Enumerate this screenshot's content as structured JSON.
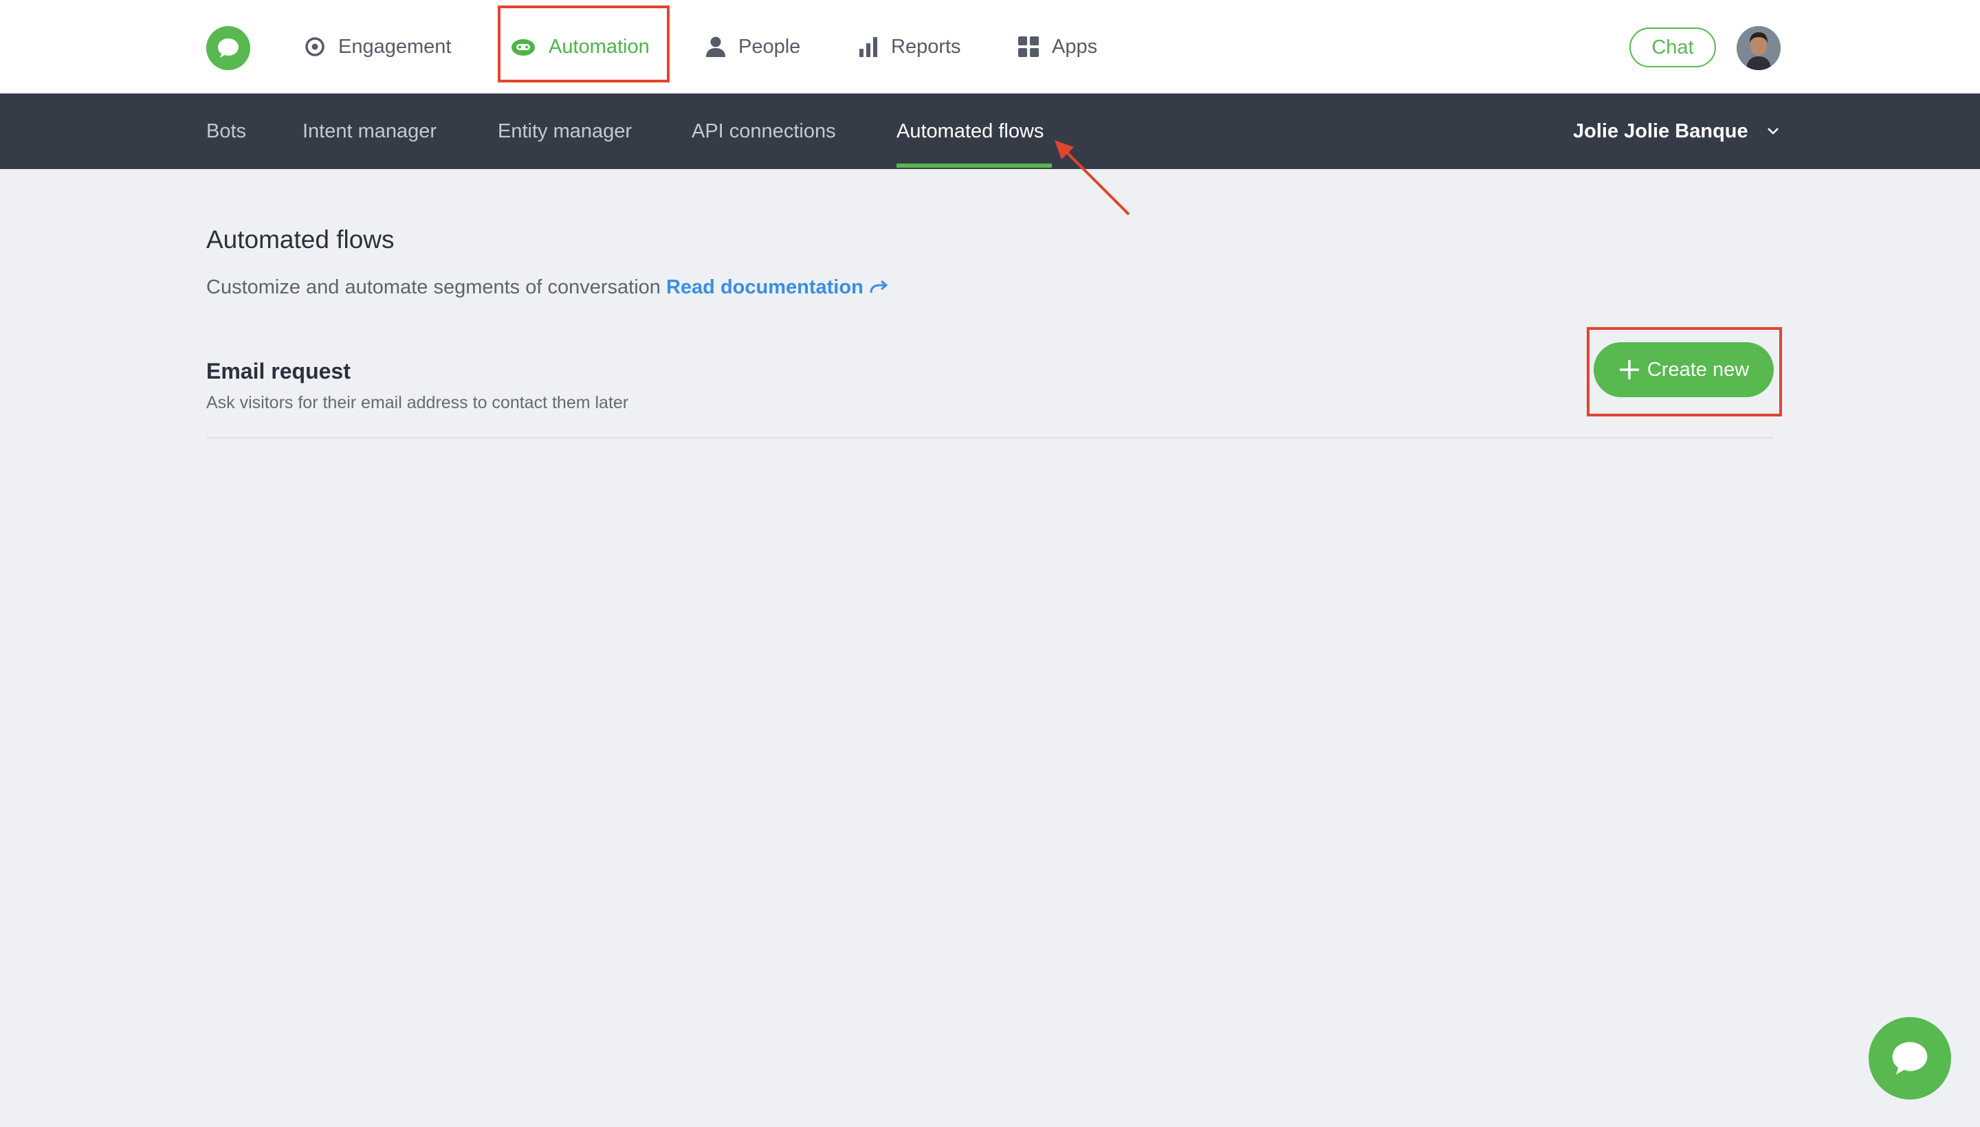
{
  "topnav": {
    "items": [
      {
        "label": "Engagement",
        "icon": "target-icon"
      },
      {
        "label": "Automation",
        "icon": "robot-icon",
        "active": true
      },
      {
        "label": "People",
        "icon": "person-icon"
      },
      {
        "label": "Reports",
        "icon": "bar-chart-icon"
      },
      {
        "label": "Apps",
        "icon": "grid-icon"
      }
    ],
    "chat_label": "Chat"
  },
  "subnav": {
    "items": [
      {
        "label": "Bots"
      },
      {
        "label": "Intent manager"
      },
      {
        "label": "Entity manager"
      },
      {
        "label": "API connections"
      },
      {
        "label": "Automated flows",
        "active": true
      }
    ],
    "account_name": "Jolie Jolie Banque"
  },
  "page": {
    "title": "Automated flows",
    "description": "Customize and automate segments of conversation",
    "doc_link": "Read documentation"
  },
  "flows": [
    {
      "title": "Email request",
      "description": "Ask visitors for their email address to contact them later",
      "button_label": "Create new"
    }
  ],
  "colors": {
    "brand_green": "#57b94f",
    "subnav_bg": "#363b48",
    "annotation_red": "#e0452e",
    "link_blue": "#3a8ee6"
  }
}
